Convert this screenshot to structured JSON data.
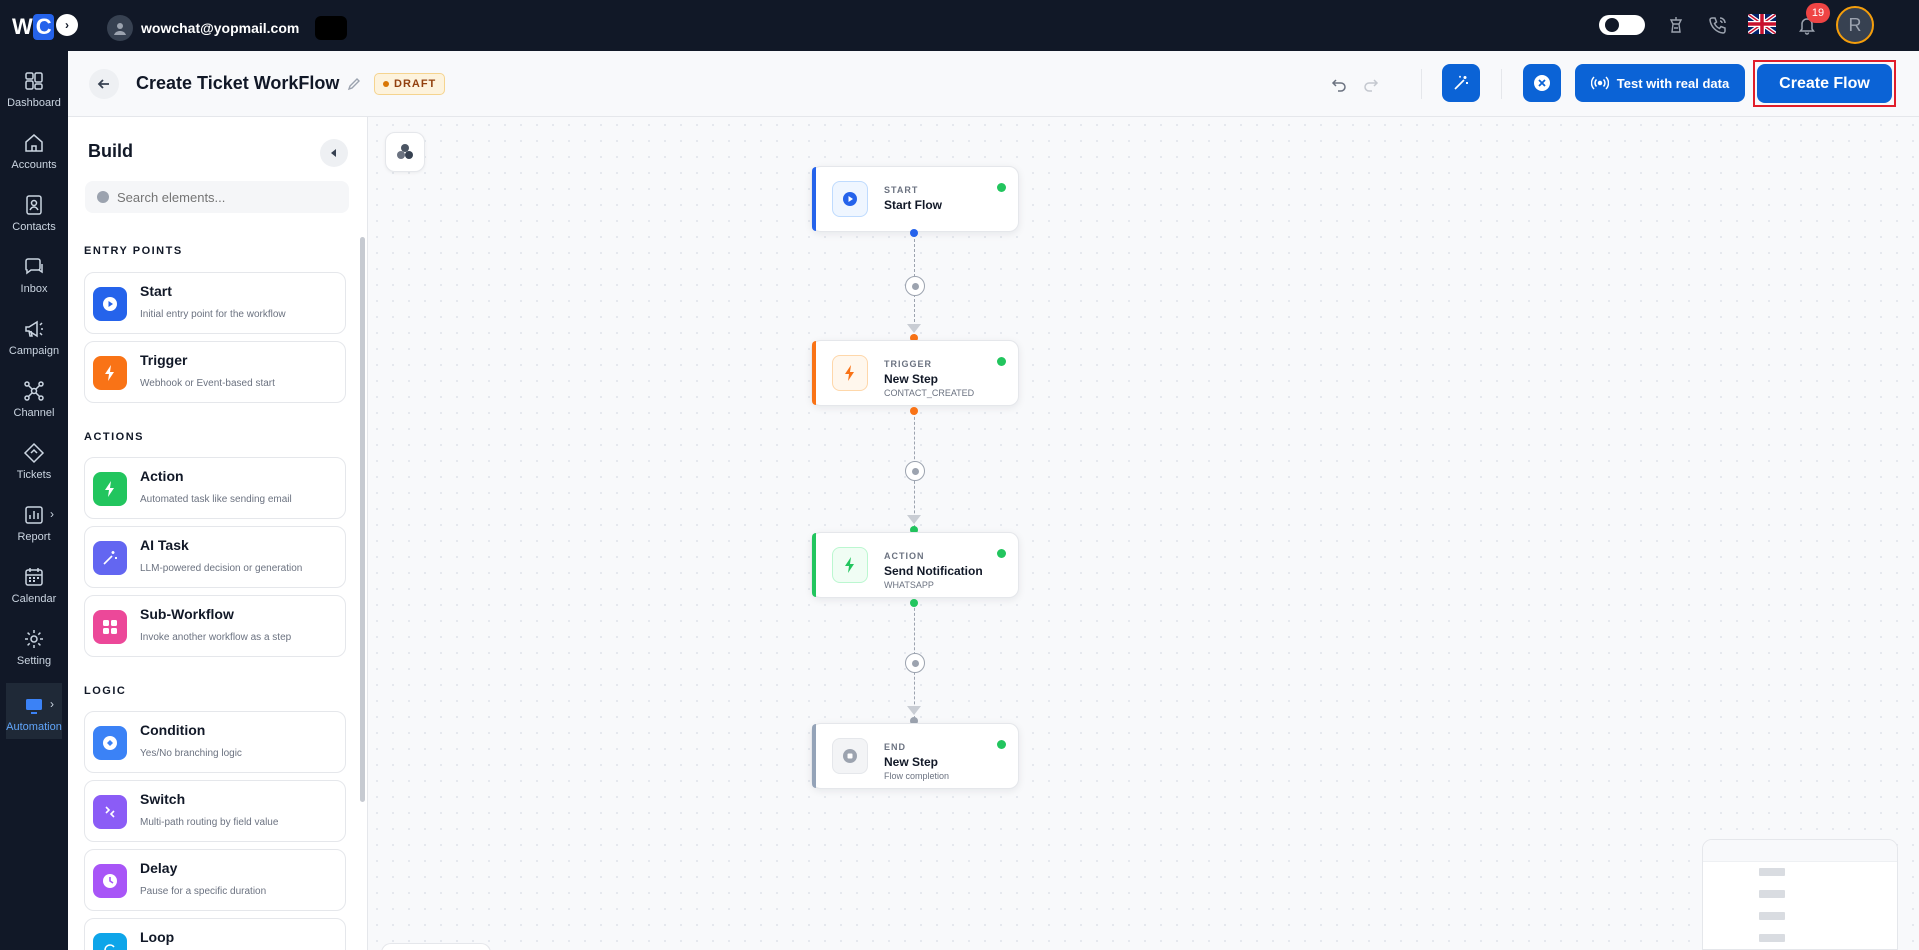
{
  "topbar": {
    "logo_text_a": "W",
    "logo_text_b": "C",
    "logo_chevron": "›",
    "user_email": "wowchat@yopmail.com",
    "notification_count": "19",
    "avatar_initial": "R",
    "icons": [
      "theme-toggle",
      "lantern-icon",
      "phone-call-icon",
      "uk-flag",
      "bell-icon"
    ]
  },
  "nav": [
    {
      "label": "Dashboard",
      "icon": "dashboard-icon"
    },
    {
      "label": "Accounts",
      "icon": "home-icon"
    },
    {
      "label": "Contacts",
      "icon": "contact-card-icon"
    },
    {
      "label": "Inbox",
      "icon": "chat-icon"
    },
    {
      "label": "Campaign",
      "icon": "megaphone-icon"
    },
    {
      "label": "Channel",
      "icon": "network-icon"
    },
    {
      "label": "Tickets",
      "icon": "ticket-icon"
    },
    {
      "label": "Report",
      "icon": "chart-icon"
    },
    {
      "label": "Calendar",
      "icon": "calendar-icon"
    },
    {
      "label": "Setting",
      "icon": "gear-icon"
    },
    {
      "label": "Automation",
      "icon": "automation-icon",
      "active": true
    }
  ],
  "header": {
    "title": "Create Ticket WorkFlow",
    "status_badge": "DRAFT",
    "test_button": "Test with real data",
    "create_button": "Create Flow"
  },
  "build": {
    "title": "Build",
    "search_placeholder": "Search elements...",
    "sections": {
      "entry": "ENTRY POINTS",
      "actions": "ACTIONS",
      "logic": "LOGIC"
    },
    "entry_points": [
      {
        "name": "Start",
        "desc": "Initial entry point for the workflow",
        "color": "#2563eb"
      },
      {
        "name": "Trigger",
        "desc": "Webhook or Event-based start",
        "color": "#f97316"
      }
    ],
    "actions": [
      {
        "name": "Action",
        "desc": "Automated task like sending email",
        "color": "#22c55e"
      },
      {
        "name": "AI Task",
        "desc": "LLM-powered decision or generation",
        "color": "#6366f1"
      },
      {
        "name": "Sub-Workflow",
        "desc": "Invoke another workflow as a step",
        "color": "#ec4899"
      }
    ],
    "logic": [
      {
        "name": "Condition",
        "desc": "Yes/No branching logic",
        "color": "#3b82f6"
      },
      {
        "name": "Switch",
        "desc": "Multi-path routing by field value",
        "color": "#8b5cf6"
      },
      {
        "name": "Delay",
        "desc": "Pause for a specific duration",
        "color": "#a855f7"
      },
      {
        "name": "Loop",
        "desc": "",
        "color": "#0ea5e9"
      }
    ]
  },
  "flow": {
    "nodes": [
      {
        "kind": "START",
        "title": "Start Flow",
        "sub": "",
        "accent": "#2563eb"
      },
      {
        "kind": "TRIGGER",
        "title": "New Step",
        "sub": "CONTACT_CREATED",
        "accent": "#f97316"
      },
      {
        "kind": "ACTION",
        "title": "Send Notification",
        "sub": "WHATSAPP",
        "accent": "#22c55e"
      },
      {
        "kind": "END",
        "title": "New Step",
        "sub": "Flow completion",
        "accent": "#94a3b8"
      }
    ]
  }
}
